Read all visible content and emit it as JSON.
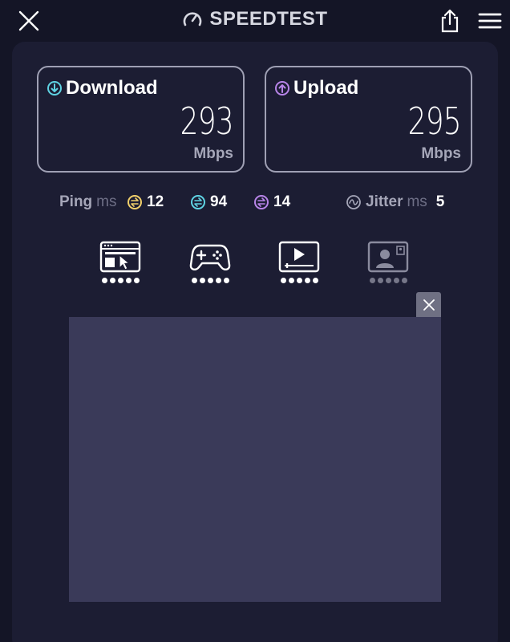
{
  "header": {
    "title": "SPEEDTEST",
    "icons": {
      "close": "close-icon",
      "logo": "speedometer-icon",
      "share": "share-icon",
      "menu": "hamburger-menu-icon"
    }
  },
  "download": {
    "label": "Download",
    "value": "293",
    "unit": "Mbps",
    "icon": "arrow-down-circle-icon",
    "color": "#5fd3e3"
  },
  "upload": {
    "label": "Upload",
    "value": "295",
    "unit": "Mbps",
    "icon": "arrow-up-circle-icon",
    "color": "#b784e8"
  },
  "ping": {
    "label": "Ping",
    "unit": "ms",
    "idle": {
      "value": "12",
      "color": "#f2d06b"
    },
    "download": {
      "value": "94",
      "color": "#5fd3e3"
    },
    "upload": {
      "value": "14",
      "color": "#b784e8"
    }
  },
  "jitter": {
    "label": "Jitter",
    "unit": "ms",
    "value": "5"
  },
  "experience": [
    {
      "icon": "web-browsing-icon",
      "rating": 5,
      "active": true
    },
    {
      "icon": "gaming-controller-icon",
      "rating": 5,
      "active": true
    },
    {
      "icon": "video-streaming-icon",
      "rating": 5,
      "active": true
    },
    {
      "icon": "video-chat-icon",
      "rating": 5,
      "active": false
    }
  ],
  "colors": {
    "background": "#141526",
    "panel": "#1c1d33",
    "ad": "#3a3a59"
  }
}
